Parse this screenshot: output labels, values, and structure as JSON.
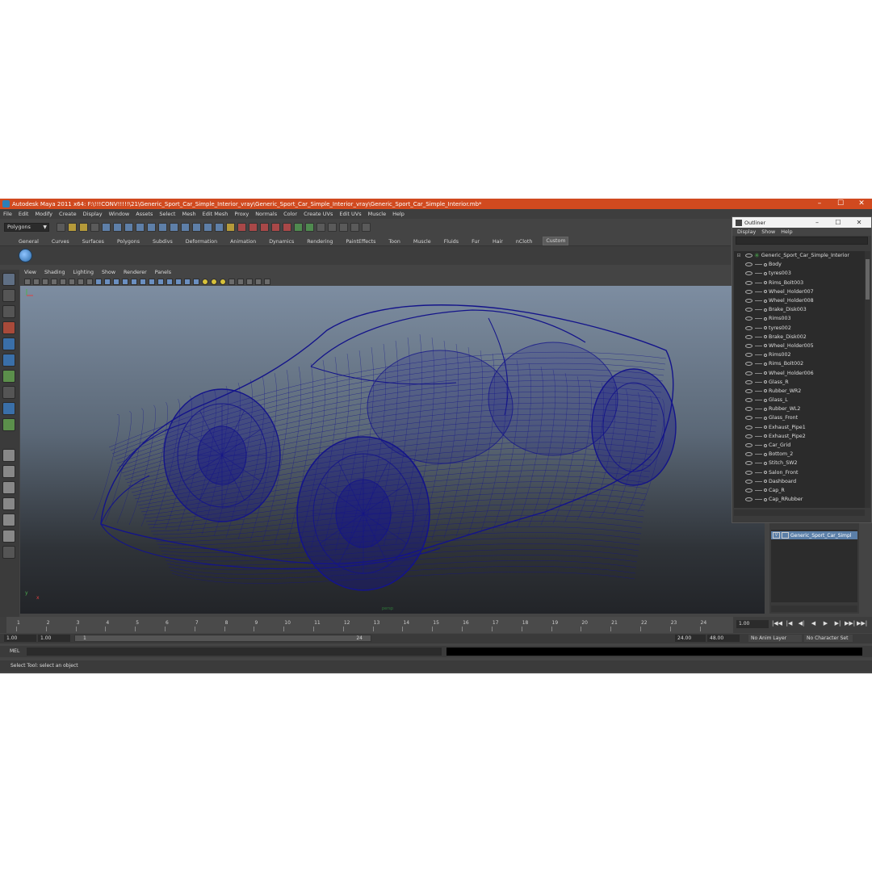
{
  "window": {
    "title": "Autodesk Maya 2011 x64: F:\\!!!CONV!!!!!\\21\\Generic_Sport_Car_Simple_Interior_vray\\Generic_Sport_Car_Simple_Interior_vray\\Generic_Sport_Car_Simple_Interior.mb*",
    "minimize": "–",
    "maximize": "☐",
    "close": "✕"
  },
  "menubar": [
    "File",
    "Edit",
    "Modify",
    "Create",
    "Display",
    "Window",
    "Assets",
    "Select",
    "Mesh",
    "Edit Mesh",
    "Proxy",
    "Normals",
    "Color",
    "Create UVs",
    "Edit UVs",
    "Muscle",
    "Help"
  ],
  "status_line": {
    "mode": "Polygons"
  },
  "shelf_tabs": [
    "General",
    "Curves",
    "Surfaces",
    "Polygons",
    "Subdivs",
    "Deformation",
    "Animation",
    "Dynamics",
    "Rendering",
    "PaintEffects",
    "Toon",
    "Muscle",
    "Fluids",
    "Fur",
    "Hair",
    "nCloth",
    "Custom"
  ],
  "active_shelf_tab": "Custom",
  "panel_menu": [
    "View",
    "Shading",
    "Lighting",
    "Show",
    "Renderer",
    "Panels"
  ],
  "viewport": {
    "camera_label": "persp",
    "wire_color": "#14148a",
    "axis": {
      "y": "y",
      "x": "x"
    }
  },
  "outliner": {
    "title": "Outliner",
    "menu": [
      "Display",
      "Show",
      "Help"
    ],
    "root": "Generic_Sport_Car_Simple_Interior",
    "items": [
      "Body",
      "tyres003",
      "Rims_Bolt003",
      "Wheel_Holder007",
      "Wheel_Holder008",
      "Brake_Disk003",
      "Rims003",
      "tyres002",
      "Brake_Disk002",
      "Wheel_Holder005",
      "Rims002",
      "Rims_Bolt002",
      "Wheel_Holder006",
      "Glass_R",
      "Rubber_WR2",
      "Glass_L",
      "Rubber_WL2",
      "Glass_Front",
      "Exhaust_Pipe1",
      "Exhaust_Pipe2",
      "Car_Grid",
      "Bottom_2",
      "Stitch_SW2",
      "Salon_Front",
      "Dashboard",
      "Cap_R",
      "Cap_RRubber"
    ]
  },
  "layer_editor": {
    "layer_name": "Generic_Sport_Car_Simpl",
    "visible_flag": "V"
  },
  "time_slider": {
    "ticks": [
      1,
      2,
      3,
      4,
      5,
      6,
      7,
      8,
      9,
      10,
      11,
      12,
      13,
      14,
      15,
      16,
      17,
      18,
      19,
      20,
      21,
      22,
      23,
      24
    ],
    "current_frame": "1.00",
    "playback_buttons": [
      "|◀◀",
      "|◀",
      "◀|",
      "◀",
      "▶",
      "▶|",
      "▶▶|",
      "▶▶|"
    ]
  },
  "range_slider": {
    "start": "1.00",
    "playback_start": "1.00",
    "range_lo": "1",
    "range_hi": "24",
    "playback_end": "24.00",
    "end": "48.00",
    "anim_layer": "No Anim Layer",
    "character_set": "No Character Set"
  },
  "command_line": {
    "label": "MEL"
  },
  "help_line": {
    "text": "Select Tool: select an object"
  }
}
